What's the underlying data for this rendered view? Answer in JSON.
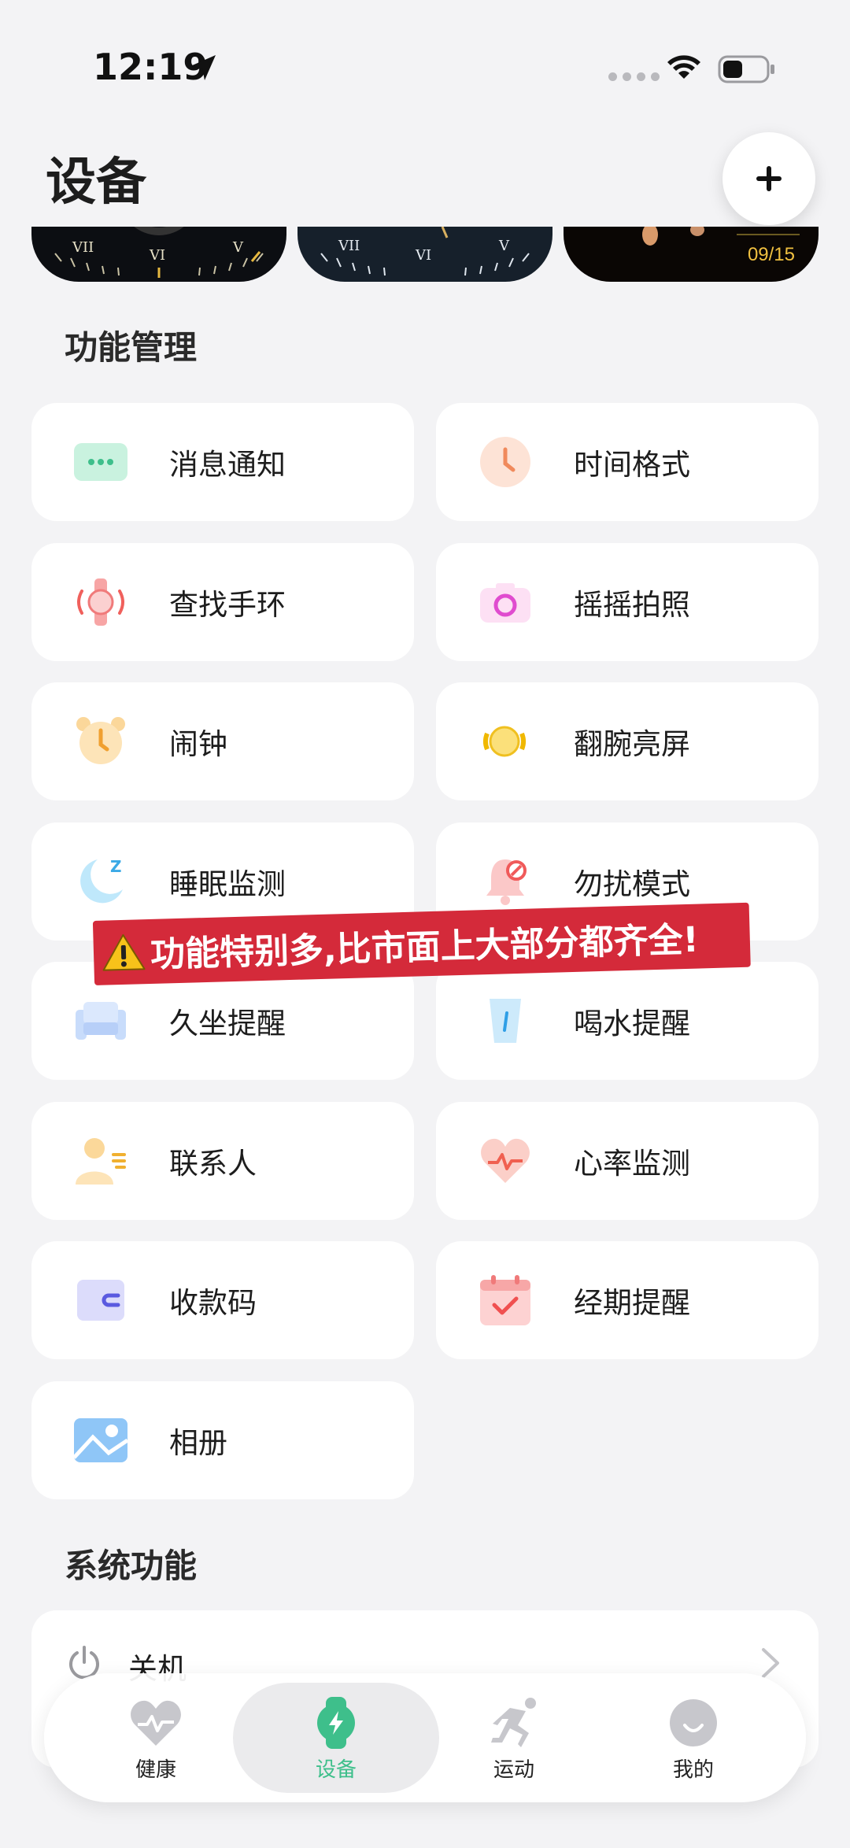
{
  "status_bar": {
    "time": "12:19"
  },
  "header": {
    "title": "设备"
  },
  "watch_faces": {
    "date": "09/15",
    "numerals": [
      "VII",
      "VI",
      "V"
    ]
  },
  "function_section": {
    "title": "功能管理",
    "items": [
      {
        "label": "消息通知",
        "icon": "message-icon"
      },
      {
        "label": "时间格式",
        "icon": "clock-icon"
      },
      {
        "label": "查找手环",
        "icon": "find-band-icon"
      },
      {
        "label": "摇摇拍照",
        "icon": "camera-icon"
      },
      {
        "label": "闹钟",
        "icon": "alarm-icon"
      },
      {
        "label": "翻腕亮屏",
        "icon": "wrist-wake-icon"
      },
      {
        "label": "睡眠监测",
        "icon": "sleep-icon"
      },
      {
        "label": "勿扰模式",
        "icon": "do-not-disturb-icon"
      },
      {
        "label": "久坐提醒",
        "icon": "sedentary-icon"
      },
      {
        "label": "喝水提醒",
        "icon": "water-icon"
      },
      {
        "label": "联系人",
        "icon": "contacts-icon"
      },
      {
        "label": "心率监测",
        "icon": "heart-rate-icon"
      },
      {
        "label": "收款码",
        "icon": "payment-code-icon"
      },
      {
        "label": "经期提醒",
        "icon": "period-calendar-icon"
      },
      {
        "label": "相册",
        "icon": "album-icon"
      }
    ]
  },
  "banner": {
    "text": "功能特别多,比市面上大部分都齐全!"
  },
  "system_section": {
    "title": "系统功能",
    "items": [
      {
        "label": "关机",
        "icon": "power-icon"
      }
    ]
  },
  "tab_bar": {
    "tabs": [
      {
        "label": "健康",
        "icon": "heart-icon"
      },
      {
        "label": "设备",
        "icon": "watch-icon",
        "active": true
      },
      {
        "label": "运动",
        "icon": "running-icon"
      },
      {
        "label": "我的",
        "icon": "profile-icon"
      }
    ],
    "active_color": "#3ebf8b"
  }
}
